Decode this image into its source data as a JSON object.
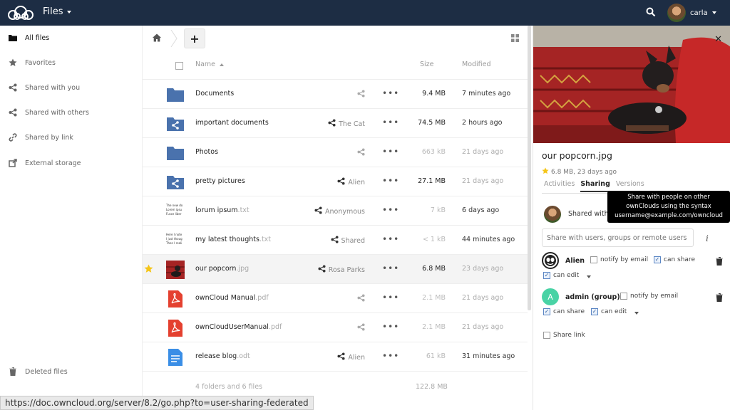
{
  "header": {
    "app_title": "Files",
    "user_name": "carla"
  },
  "sidebar": {
    "items": [
      {
        "label": "All files",
        "icon": "folder-icon"
      },
      {
        "label": "Favorites",
        "icon": "star-icon"
      },
      {
        "label": "Shared with you",
        "icon": "share-icon"
      },
      {
        "label": "Shared with others",
        "icon": "share-icon"
      },
      {
        "label": "Shared by link",
        "icon": "link-icon"
      },
      {
        "label": "External storage",
        "icon": "external-icon"
      }
    ],
    "deleted": "Deleted files"
  },
  "table": {
    "col_name": "Name",
    "col_size": "Size",
    "col_modified": "Modified",
    "rows": [
      {
        "name": "Documents",
        "ext": "",
        "type": "folder",
        "share": "",
        "size": "9.4 MB",
        "modified": "7 minutes ago",
        "star": false
      },
      {
        "name": "important documents",
        "ext": "",
        "type": "shared-folder",
        "share": "The Cat",
        "size": "74.5 MB",
        "modified": "2 hours ago",
        "star": false
      },
      {
        "name": "Photos",
        "ext": "",
        "type": "folder",
        "share": "",
        "size": "663 kB",
        "modified": "21 days ago",
        "star": false
      },
      {
        "name": "pretty pictures",
        "ext": "",
        "type": "shared-folder",
        "share": "Alien",
        "size": "27.1 MB",
        "modified": "21 days ago",
        "star": false
      },
      {
        "name": "lorum ipsum",
        "ext": ".txt",
        "type": "text",
        "share": "Anonymous",
        "size": "7 kB",
        "modified": "6 days ago",
        "star": false,
        "thumb": [
          "The new do",
          "Lorem ipsu",
          "Fusce liber"
        ]
      },
      {
        "name": "my latest thoughts",
        "ext": ".txt",
        "type": "text",
        "share": "Shared",
        "size": "< 1 kB",
        "modified": "44 minutes ago",
        "star": false,
        "thumb": [
          "Here I note",
          "I just thoug",
          "Then I reali"
        ]
      },
      {
        "name": "our popcorn",
        "ext": ".jpg",
        "type": "image",
        "share": "Rosa Parks",
        "size": "6.8 MB",
        "modified": "23 days ago",
        "star": true
      },
      {
        "name": "ownCloud Manual",
        "ext": ".pdf",
        "type": "pdf",
        "share": "",
        "size": "2.1 MB",
        "modified": "21 days ago",
        "star": false
      },
      {
        "name": "ownCloudUserManual",
        "ext": ".pdf",
        "type": "pdf",
        "share": "",
        "size": "2.1 MB",
        "modified": "21 days ago",
        "star": false
      },
      {
        "name": "release blog",
        "ext": ".odt",
        "type": "doc",
        "share": "Alien",
        "size": "61 kB",
        "modified": "31 minutes ago",
        "star": false
      }
    ],
    "summary": "4 folders and 6 files",
    "summary_size": "122.8 MB"
  },
  "panel": {
    "title": "our popcorn.jpg",
    "meta": "6.8 MB, 23 days ago",
    "tabs": [
      "Activities",
      "Sharing",
      "Versions"
    ],
    "owner_text": "Shared with y",
    "input_placeholder": "Share with users, groups or remote users ...",
    "tooltip": [
      "Share with people on other",
      "ownClouds using the syntax",
      "username@example.com/owncloud"
    ],
    "sharees": [
      {
        "name": "Alien",
        "notify": "notify by email",
        "can_share": "can share",
        "can_edit": "can edit"
      },
      {
        "name": "admin (group)",
        "initial": "A",
        "notify": "notify by email",
        "can_share": "can share",
        "can_edit": "can edit"
      }
    ],
    "share_link": "Share link"
  },
  "statusbar": "https://doc.owncloud.org/server/8.2/go.php?to=user-sharing-federated",
  "colors": {
    "header": "#1d2d44",
    "folder": "#4a72ad",
    "accent_green": "#49d3a5",
    "pdf": "#e4402f",
    "doc": "#3a8ee6",
    "star": "#f5c518"
  }
}
